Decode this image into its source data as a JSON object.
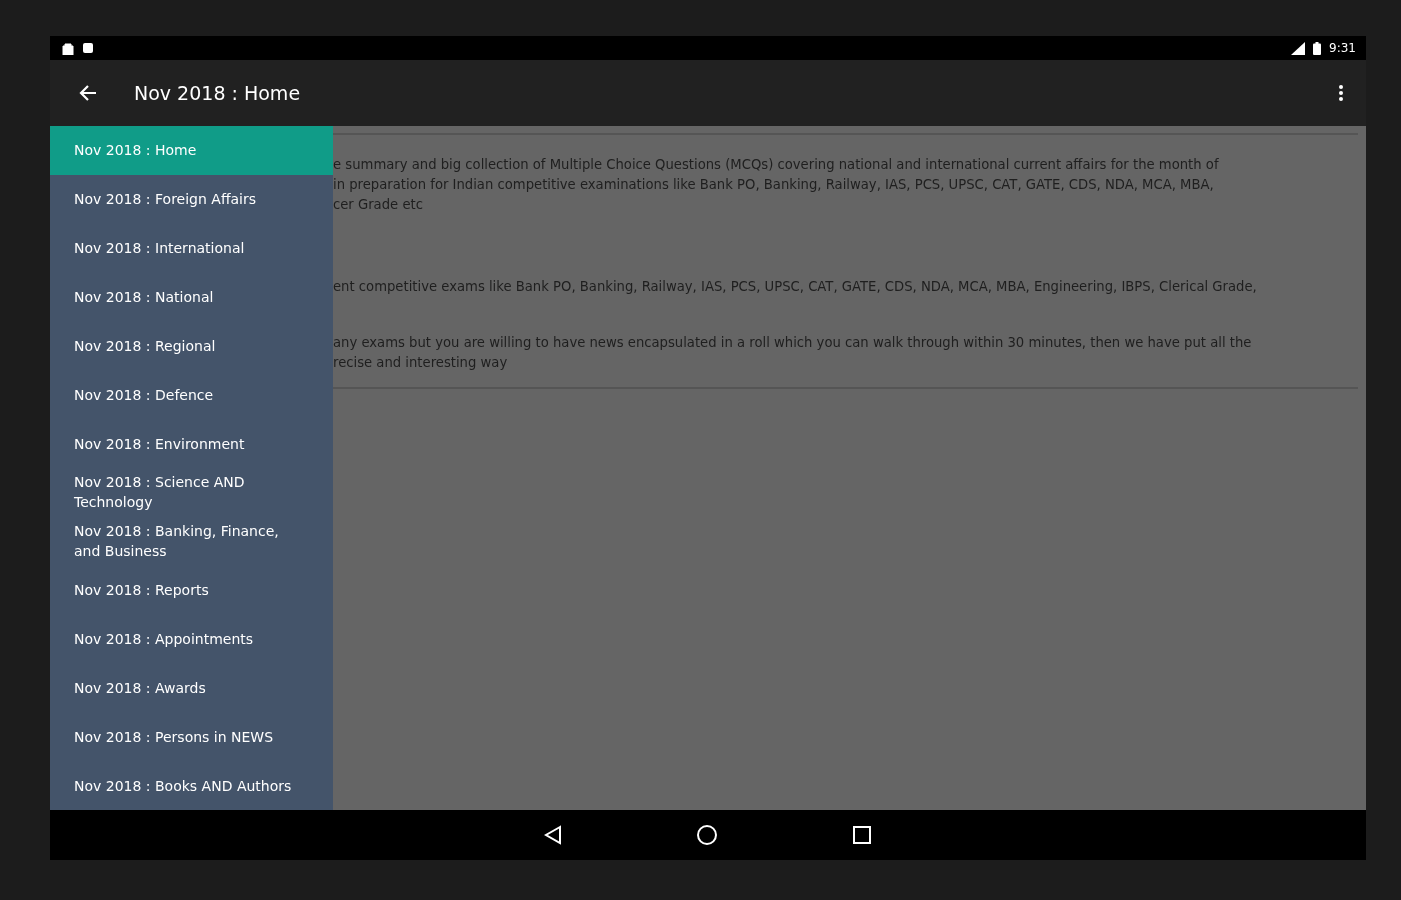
{
  "status_bar": {
    "time": "9:31"
  },
  "app_bar": {
    "title": "Nov 2018 : Home"
  },
  "drawer": {
    "items": [
      {
        "label": "Nov 2018 : Home",
        "selected": true
      },
      {
        "label": "Nov 2018 : Foreign Affairs",
        "selected": false
      },
      {
        "label": "Nov 2018 : International",
        "selected": false
      },
      {
        "label": "Nov 2018 : National",
        "selected": false
      },
      {
        "label": "Nov 2018 : Regional",
        "selected": false
      },
      {
        "label": "Nov 2018 : Defence",
        "selected": false
      },
      {
        "label": "Nov 2018 : Environment",
        "selected": false
      },
      {
        "label": "Nov 2018 : Science AND Technology",
        "selected": false
      },
      {
        "label": "Nov 2018 : Banking, Finance, and Business",
        "selected": false
      },
      {
        "label": "Nov 2018 : Reports",
        "selected": false
      },
      {
        "label": "Nov 2018 : Appointments",
        "selected": false
      },
      {
        "label": "Nov 2018 : Awards",
        "selected": false
      },
      {
        "label": "Nov 2018 : Persons in NEWS",
        "selected": false
      },
      {
        "label": "Nov 2018 : Books AND Authors",
        "selected": false
      }
    ]
  },
  "content": {
    "paragraphs": [
      {
        "lines": [
          "e summary and big collection of Multiple Choice Questions (MCQs) covering national and international current affairs for the month of",
          "in preparation for Indian competitive examinations like Bank PO, Banking, Railway, IAS, PCS, UPSC, CAT, GATE, CDS, NDA, MCA, MBA,",
          "cer Grade etc"
        ]
      },
      {
        "lines": [
          "ent competitive exams like Bank PO, Banking, Railway, IAS, PCS, UPSC, CAT, GATE, CDS, NDA, MCA, MBA, Engineering, IBPS, Clerical Grade,"
        ]
      },
      {
        "lines": [
          "any exams but you are willing to have news encapsulated in a roll which you can walk through within 30 minutes, then we have put all the",
          "recise and interesting way"
        ]
      }
    ]
  }
}
